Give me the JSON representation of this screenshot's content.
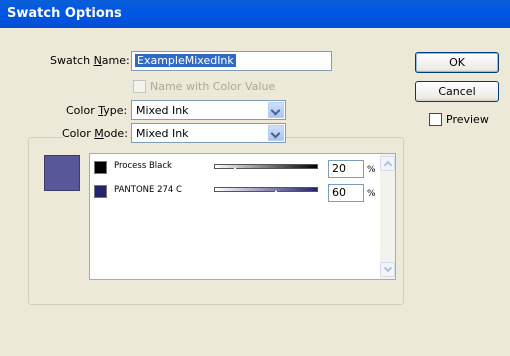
{
  "window": {
    "title": "Swatch Options"
  },
  "form": {
    "swatch_name_label_pre": "Swatch ",
    "swatch_name_label_u": "N",
    "swatch_name_label_post": "ame:",
    "swatch_name_value": "ExampleMixedInk",
    "name_with_color_value_label": "Name with Color Value",
    "name_with_color_value_checked": false,
    "color_type_label_pre": "Color ",
    "color_type_label_u": "T",
    "color_type_label_post": "ype:",
    "color_type_value": "Mixed Ink",
    "color_mode_label_pre": "Color ",
    "color_mode_label_u": "M",
    "color_mode_label_post": "ode:",
    "color_mode_value": "Mixed Ink"
  },
  "buttons": {
    "ok": "OK",
    "cancel": "Cancel",
    "preview_label": "Preview",
    "preview_checked": false
  },
  "swatch": {
    "preview_color": "#57579a"
  },
  "inks": [
    {
      "name": "Process Black",
      "color": "#000000",
      "percent": "20",
      "percent_sign": "%",
      "level": 0.2,
      "track_end_color": "#000000"
    },
    {
      "name": "PANTONE 274 C",
      "color": "#23236e",
      "percent": "60",
      "percent_sign": "%",
      "level": 0.6,
      "track_end_color": "#23236e"
    }
  ],
  "colors": {
    "titlebar": "#0058e6",
    "dialog_bg": "#ece9d8",
    "selection": "#316ac5"
  }
}
